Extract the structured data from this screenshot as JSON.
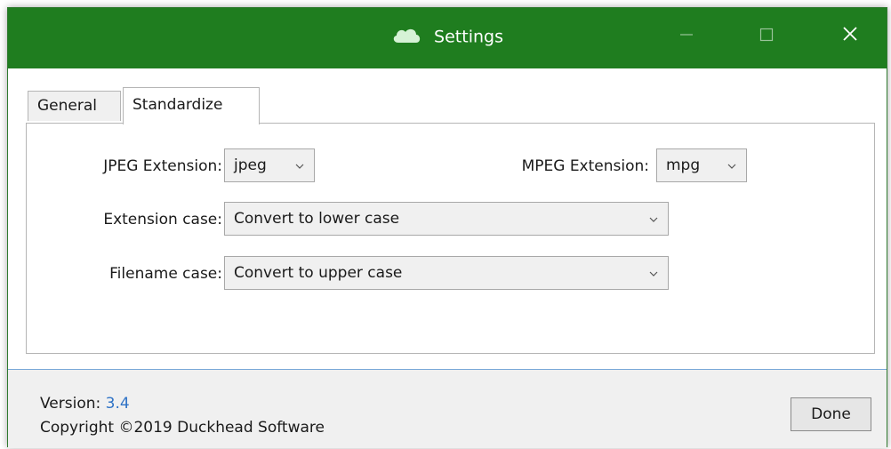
{
  "window": {
    "title": "Settings",
    "icons": {
      "app": "cloud-icon",
      "minimize": "minimize-icon",
      "maximize": "maximize-icon",
      "close": "close-icon"
    },
    "colors": {
      "titlebar": "#1f7d1f",
      "link": "#2f73c6"
    }
  },
  "tabs": [
    {
      "label": "General",
      "active": false
    },
    {
      "label": "Standardize",
      "active": true
    }
  ],
  "form": {
    "jpeg": {
      "label": "JPEG Extension:",
      "value": "jpeg"
    },
    "mpeg": {
      "label": "MPEG Extension:",
      "value": "mpg"
    },
    "extension_case": {
      "label": "Extension case:",
      "value": "Convert to lower case"
    },
    "filename_case": {
      "label": "Filename case:",
      "value": "Convert to upper case"
    }
  },
  "footer": {
    "version_label": "Version:",
    "version": "3.4",
    "copyright": "Copyright ©2019 Duckhead Software",
    "done_label": "Done"
  }
}
